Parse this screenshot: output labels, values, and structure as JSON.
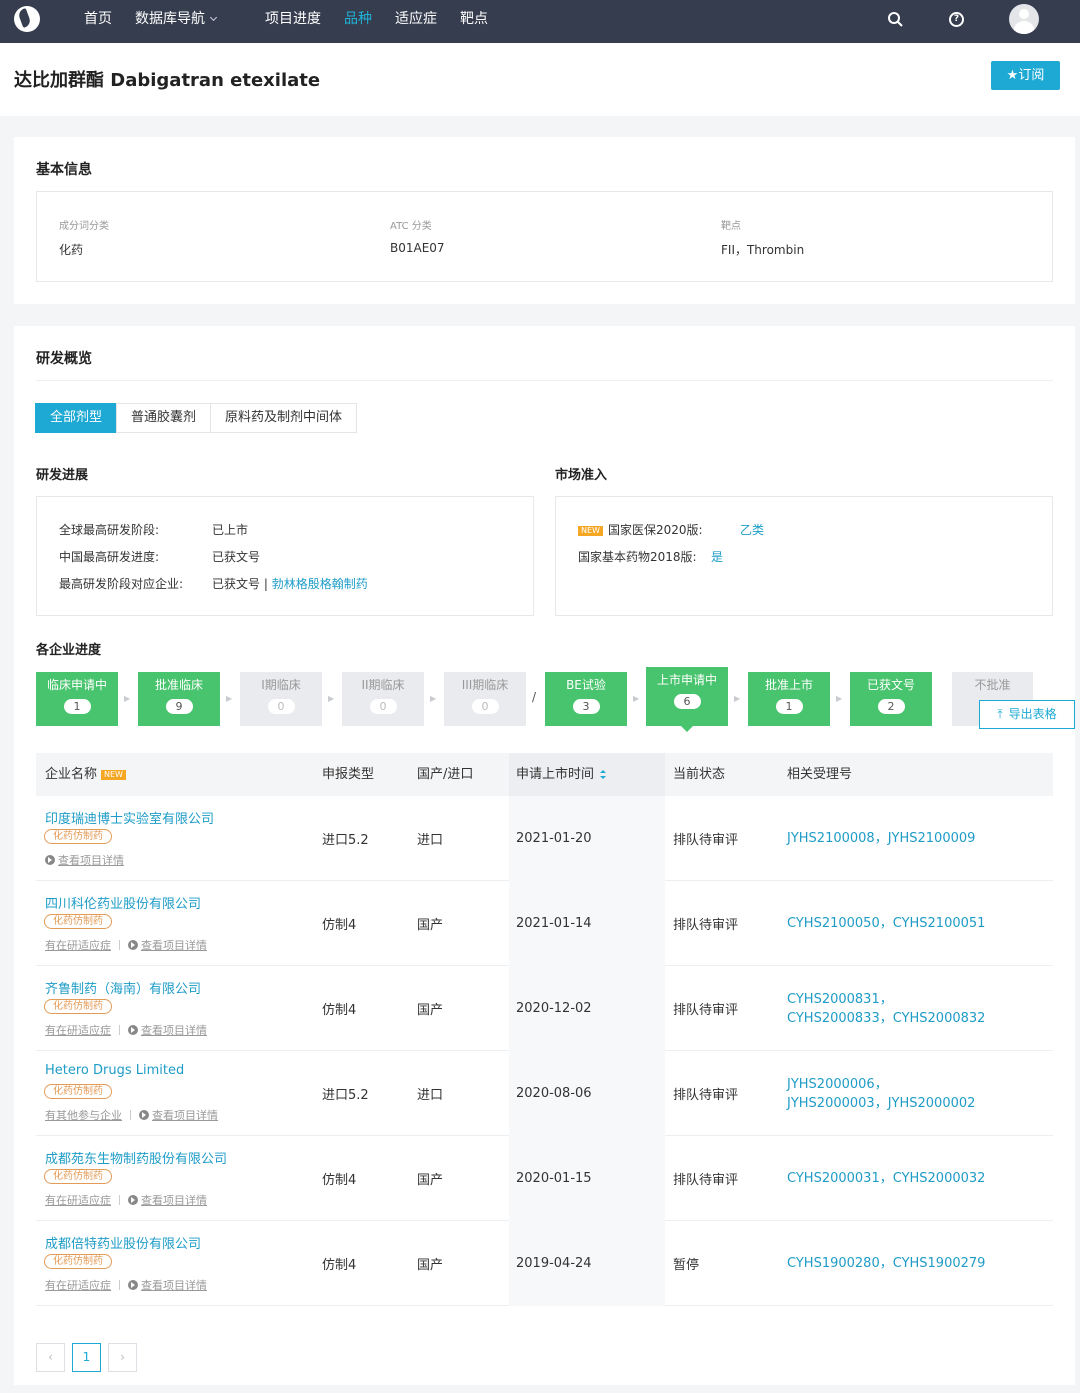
{
  "nav": {
    "items": [
      "首页",
      "数据库导航",
      "项目进度",
      "品种",
      "适应症",
      "靶点"
    ],
    "active_index": 3
  },
  "title": {
    "text": "达比加群酯 Dabigatran etexilate",
    "subscribe": "★订阅"
  },
  "basic": {
    "heading": "基本信息",
    "fields": [
      {
        "label": "成分词分类",
        "value": "化药"
      },
      {
        "label": "ATC 分类",
        "value": "B01AE07"
      },
      {
        "label": "靶点",
        "value": "FII，Thrombin"
      }
    ]
  },
  "overview": {
    "heading": "研发概览",
    "tabs": [
      "全部剂型",
      "普通胶囊剂",
      "原料药及制剂中间体"
    ],
    "progress": {
      "heading": "研发进展",
      "rows": [
        {
          "label": "全球最高研发阶段:",
          "value": "已上市"
        },
        {
          "label": "中国最高研发进度:",
          "value": "已获文号"
        },
        {
          "label": "最高研发阶段对应企业:",
          "value": "已获文号 | ",
          "link": "勃林格殷格翰制药"
        }
      ]
    },
    "market": {
      "heading": "市场准入",
      "new_badge": "NEW",
      "rows": [
        {
          "label": "国家医保2020版:",
          "value": "乙类"
        },
        {
          "label": "国家基本药物2018版:",
          "value": "是"
        }
      ]
    }
  },
  "companies": {
    "heading": "各企业进度",
    "stages": [
      {
        "label": "临床申请中",
        "count": "1"
      },
      {
        "label": "批准临床",
        "count": "9"
      },
      {
        "label": "I期临床",
        "count": "0"
      },
      {
        "label": "II期临床",
        "count": "0"
      },
      {
        "label": "III期临床",
        "count": "0"
      },
      {
        "label": "BE试验",
        "count": "3"
      },
      {
        "label": "上市申请中",
        "count": "6"
      },
      {
        "label": "批准上市",
        "count": "1"
      },
      {
        "label": "已获文号",
        "count": "2"
      },
      {
        "label": "不批准",
        "count": ""
      }
    ],
    "export": "导出表格",
    "columns": [
      "企业名称",
      "申报类型",
      "国产/进口",
      "申请上市时间",
      "当前状态",
      "相关受理号"
    ],
    "col_badge": "NEW",
    "rows": [
      {
        "company": "印度瑞迪博士实验室有限公司",
        "tag": "化药仿制药",
        "link1": "",
        "link2": "查看项目详情",
        "type": "进口5.2",
        "origin": "进口",
        "date": "2021-01-20",
        "status": "排队待审评",
        "numbers": "JYHS2100008，JYHS2100009"
      },
      {
        "company": "四川科伦药业股份有限公司",
        "tag": "化药仿制药",
        "link1": "有在研适应症",
        "link2": "查看项目详情",
        "type": "仿制4",
        "origin": "国产",
        "date": "2021-01-14",
        "status": "排队待审评",
        "numbers": "CYHS2100050，CYHS2100051"
      },
      {
        "company": "齐鲁制药（海南）有限公司",
        "tag": "化药仿制药",
        "link1": "有在研适应症",
        "link2": "查看项目详情",
        "type": "仿制4",
        "origin": "国产",
        "date": "2020-12-02",
        "status": "排队待审评",
        "numbers": "CYHS2000831，CYHS2000833，CYHS2000832"
      },
      {
        "company": "Hetero Drugs Limited",
        "tag": "化药仿制药",
        "link1": "有其他参与企业",
        "link2": "查看项目详情",
        "type": "进口5.2",
        "origin": "进口",
        "date": "2020-08-06",
        "status": "排队待审评",
        "numbers": "JYHS2000006，JYHS2000003，JYHS2000002"
      },
      {
        "company": "成都苑东生物制药股份有限公司",
        "tag": "化药仿制药",
        "link1": "有在研适应症",
        "link2": "查看项目详情",
        "type": "仿制4",
        "origin": "国产",
        "date": "2020-01-15",
        "status": "排队待审评",
        "numbers": "CYHS2000031，CYHS2000032"
      },
      {
        "company": "成都倍特药业股份有限公司",
        "tag": "化药仿制药",
        "link1": "有在研适应症",
        "link2": "查看项目详情",
        "type": "仿制4",
        "origin": "国产",
        "date": "2019-04-24",
        "status": "暂停",
        "numbers": "CYHS1900280，CYHS1900279"
      }
    ],
    "pagination": {
      "prev": "‹",
      "current": "1",
      "next": "›"
    }
  }
}
